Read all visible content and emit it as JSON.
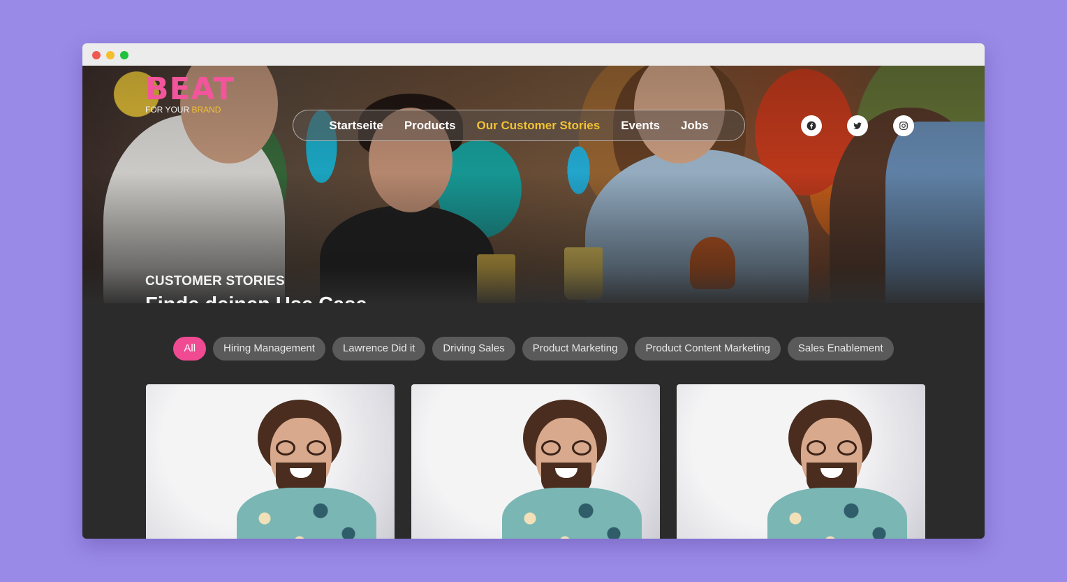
{
  "window": {
    "controls": [
      "close",
      "minimize",
      "maximize"
    ]
  },
  "brand": {
    "logo_text": "BEAT",
    "tagline_prefix": "FOR YOUR",
    "tagline_accent": "BRAND",
    "accent_pink": "#f2559b",
    "accent_yellow": "#f2c233"
  },
  "nav": {
    "items": [
      {
        "label": "Startseite",
        "active": false
      },
      {
        "label": "Products",
        "active": false
      },
      {
        "label": "Our Customer Stories",
        "active": true
      },
      {
        "label": "Events",
        "active": false
      },
      {
        "label": "Jobs",
        "active": false
      }
    ]
  },
  "social": [
    {
      "icon": "facebook-icon"
    },
    {
      "icon": "twitter-icon"
    },
    {
      "icon": "instagram-icon"
    }
  ],
  "hero": {
    "eyebrow": "CUSTOMER STORIES",
    "headline": "Finde deinen Use Case"
  },
  "filters": {
    "items": [
      {
        "label": "All",
        "active": true
      },
      {
        "label": "Hiring Management",
        "active": false
      },
      {
        "label": "Lawrence Did it",
        "active": false
      },
      {
        "label": "Driving Sales",
        "active": false
      },
      {
        "label": "Product Marketing",
        "active": false
      },
      {
        "label": "Product Content Marketing",
        "active": false
      },
      {
        "label": "Sales Enablement",
        "active": false
      }
    ]
  },
  "cards": {
    "count_visible": 3
  }
}
